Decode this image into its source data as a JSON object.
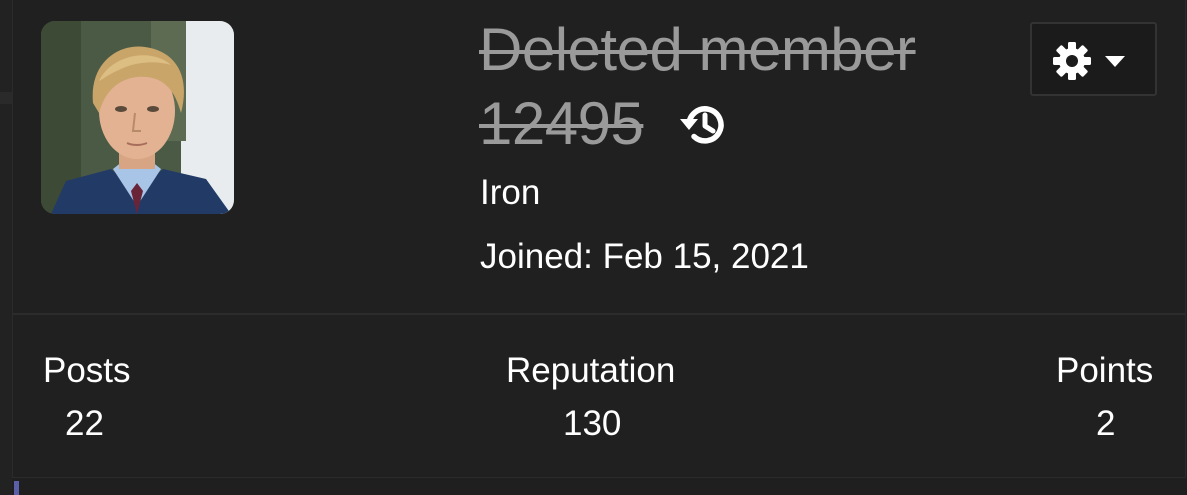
{
  "profile": {
    "username": "Deleted member 12495",
    "rank": "Iron",
    "joined": "Joined: Feb 15, 2021",
    "avatar_icon": "member-photo",
    "history_icon": "history-icon",
    "settings_icon": "gear-icon",
    "settings_caret_icon": "caret-down-icon"
  },
  "stats": {
    "posts_label": "Posts",
    "posts_value": "22",
    "reputation_label": "Reputation",
    "reputation_value": "130",
    "points_label": "Points",
    "points_value": "2"
  },
  "colors": {
    "background": "#1f1f1f",
    "card": "#202020",
    "username_strikethrough": "#9a9a9a",
    "text": "#ffffff",
    "accent": "#5a5fa8"
  }
}
